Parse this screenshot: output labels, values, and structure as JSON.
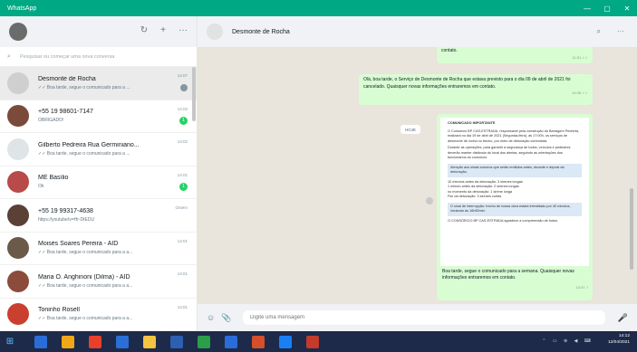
{
  "window": {
    "title": "WhatsApp",
    "controls": [
      "—",
      "▢",
      "✕"
    ]
  },
  "sidebar": {
    "icons": {
      "status": "↻",
      "new_chat": "+",
      "menu": "···"
    },
    "search_placeholder": "Pesquisar ou começar uma nova conversa",
    "chats": [
      {
        "name": "Desmonte de Rocha",
        "preview": "✓✓ Boa tarde, segue o comunicado para a ...",
        "time": "14:07",
        "pinned": true,
        "badge": "",
        "avatar_color": "#cfcfcf"
      },
      {
        "name": "+55 19 98601-7147",
        "preview": "OBRIGADO!",
        "time": "14:02",
        "badge": "1",
        "avatar_color": "#7a4a3a"
      },
      {
        "name": "Gilberto Pedreira Rua Germiniano...",
        "preview": "✓✓ Boa tarde, segue o comunicado para a ...",
        "time": "14:02",
        "badge": "",
        "avatar_color": "#dfe5e7"
      },
      {
        "name": "ME Basílio",
        "preview": "Ok",
        "time": "14:01",
        "badge": "1",
        "avatar_color": "#b84a4a"
      },
      {
        "name": "+55 19 99317-4638",
        "preview": "https://youtube/v=Hr-DtEDU",
        "time": "Ontem",
        "badge": "",
        "avatar_color": "#5a4035"
      },
      {
        "name": "Moisés Soares Pereira - AID",
        "preview": "✓✓ Boa tarde, segue o comunicado para a a...",
        "time": "14:01",
        "badge": "",
        "avatar_color": "#6b5a4a"
      },
      {
        "name": "Maria O. Anghinoni (Dilma) - AID",
        "preview": "✓✓ Boa tarde, segue o comunicado para a a...",
        "time": "14:01",
        "badge": "",
        "avatar_color": "#8b4c3c"
      },
      {
        "name": "Toninho Rosell",
        "preview": "✓✓ Boa tarde, segue o comunicado para a a...",
        "time": "14:01",
        "badge": "",
        "avatar_color": "#c94030"
      }
    ]
  },
  "main": {
    "contact_name": "Desmonte de Rocha",
    "icons": {
      "search": "⌕",
      "menu": "···"
    },
    "messages": {
      "top_fragment": "contato.",
      "top_time": "11:51 ✓✓",
      "status_msg": "Olá, boa tarde, o Serviço de Desmonte de Rocha que estava previsto para o dia 09 de abril de 2021 foi cancelado. Quaisquer novas informações entraremos em contato.",
      "status_time": "14:06 ✓✓",
      "day_chip": "HOJE",
      "doc_title": "COMUNICADO IMPORTANTE",
      "doc_intro": "O Consórcio BP CAS-ESTRADA, responsável pela construção do Barragem Pedreira, realizará no dia 19 de abril de 2021 (Segunda-feira), às 17:00h, os serviços de desmonte de rocha no trecho, por meio de detonação controlada.",
      "doc_body": "Durante as operações, para garantir a segurança de todos, veículos e pedestres deverão manter distância do local dos alertas, seguindo as orientações dos funcionários do consórcio.",
      "doc_box": "Atenção aos sinais sonoros que serão emitidos antes, durante e depois da detonação.",
      "doc_steps": [
        "10 minutos antes da detonação: 3 sirenes longas",
        "1 minuto antes da detonação: 2 sirenes longas",
        "no momento da detonação: 1 sirene longa",
        "Fim da detonação: 3 sirenes curtas"
      ],
      "doc_notice": "O sinal de interrupção: trecho de nossa obra estará interditado por 40 minutos, iniciando às 16h50min.",
      "doc_footer": "O CONSÓRCIO BP CAS-ESTRADA agradece a compreensão de todos.",
      "doc_caption": "Boa tarde, segue o comunicado para a semana. Quaisquer novas informações entraremos em contato.",
      "doc_time": "14:07 ✓"
    },
    "composer": {
      "emoji_icon": "☺",
      "attach_icon": "📎",
      "placeholder": "Digite uma mensagem",
      "mic_icon": "🎤"
    }
  },
  "taskbar": {
    "start_icon": "⊞",
    "apps": [
      "#2a6dd8",
      "#f0a818",
      "#e8402a",
      "#2b6fd6",
      "#f5c342",
      "#2d5fb3",
      "#2b9e4a",
      "#2a6dd8",
      "#d54f2b",
      "#1a7ff5",
      "#c43a2b"
    ],
    "tray_icons": "⌃ ▭ ⊕ ◀ ⌨",
    "time": "14:12",
    "date": "12/04/2021"
  }
}
